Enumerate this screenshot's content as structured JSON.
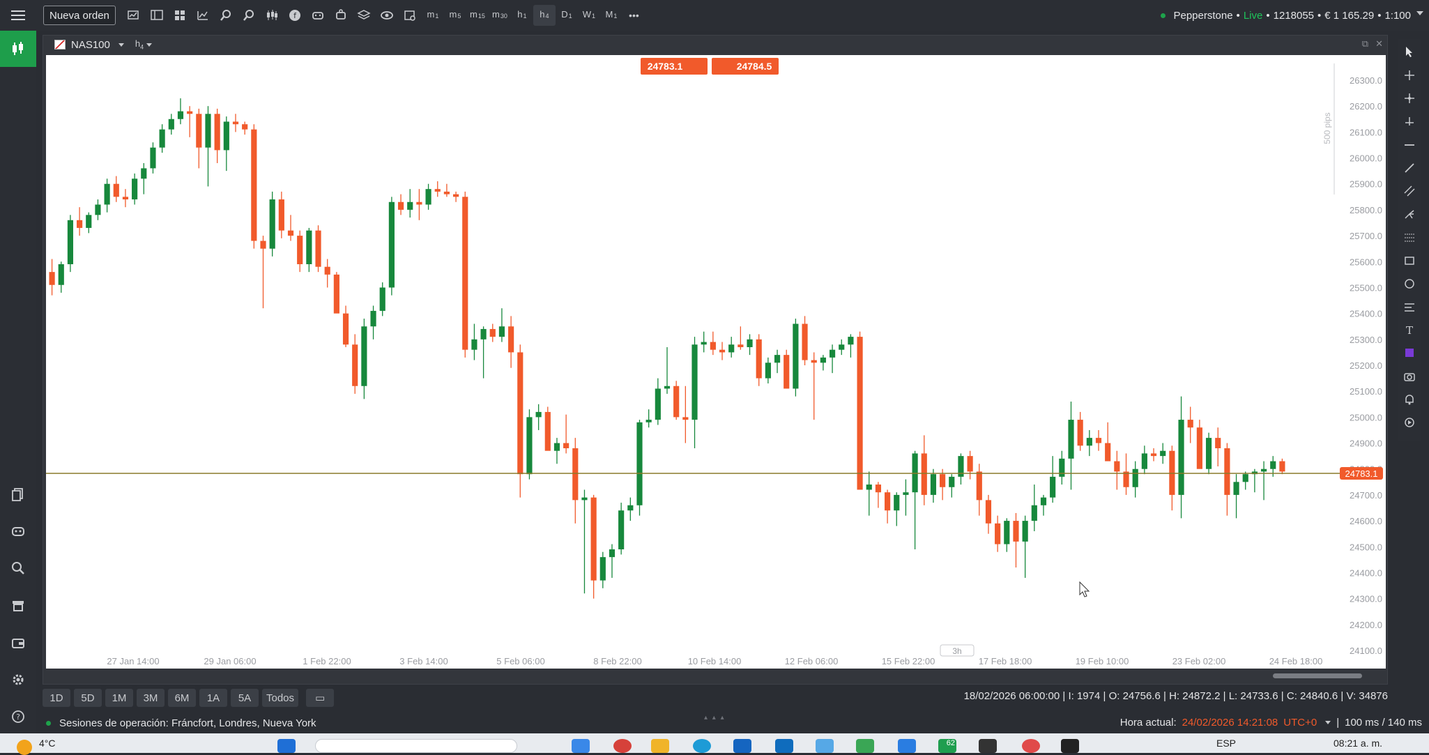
{
  "toolbar": {
    "new_order_label": "Nueva orden",
    "timeframes": [
      {
        "label": "m",
        "sub": "1"
      },
      {
        "label": "m",
        "sub": "5"
      },
      {
        "label": "m",
        "sub": "15"
      },
      {
        "label": "m",
        "sub": "30"
      },
      {
        "label": "h",
        "sub": "1"
      },
      {
        "label": "h",
        "sub": "4"
      },
      {
        "label": "D",
        "sub": "1"
      },
      {
        "label": "W",
        "sub": "1"
      },
      {
        "label": "M",
        "sub": "1"
      }
    ],
    "active_timeframe": "h4",
    "more_label": "•••"
  },
  "account": {
    "broker": "Pepperstone",
    "sep1": "•",
    "mode": "Live",
    "sep2": "•",
    "number": "1218055",
    "sep3": "•",
    "balance": "€ 1 165.29",
    "sep4": "•",
    "leverage": "1:100"
  },
  "chart_window": {
    "symbol": "NAS100",
    "timeframe_label": "h",
    "timeframe_sub": "4",
    "bid_label": "24783.1",
    "ask_label": "24784.5",
    "pips_label": "500 pips",
    "collapsed_label": "3h",
    "price_marker": "24783.1"
  },
  "chart_data": {
    "type": "candlestick",
    "symbol": "NAS100",
    "timeframe": "h4",
    "y_axis_labels": [
      "26300.0",
      "26200.0",
      "26100.0",
      "26000.0",
      "25900.0",
      "25800.0",
      "25700.0",
      "25600.0",
      "25500.0",
      "25400.0",
      "25300.0",
      "25200.0",
      "25100.0",
      "25000.0",
      "24900.0",
      "24800.0",
      "24700.0",
      "24600.0",
      "24500.0",
      "24400.0",
      "24300.0",
      "24200.0",
      "24100.0"
    ],
    "ylim": [
      24100,
      26300
    ],
    "x_axis_labels": [
      "27 Jan 14:00",
      "29 Jan 06:00",
      "1 Feb 22:00",
      "3 Feb 14:00",
      "5 Feb 06:00",
      "8 Feb 22:00",
      "10 Feb 14:00",
      "12 Feb 06:00",
      "15 Feb 22:00",
      "17 Feb 18:00",
      "19 Feb 10:00",
      "23 Feb 02:00",
      "24 Feb 18:00"
    ],
    "current_price": 24783.1,
    "candles": [
      [
        25560,
        25610,
        25470,
        25510
      ],
      [
        25510,
        25600,
        25480,
        25590
      ],
      [
        25590,
        25780,
        25560,
        25760
      ],
      [
        25760,
        25810,
        25700,
        25730
      ],
      [
        25730,
        25790,
        25710,
        25780
      ],
      [
        25780,
        25840,
        25760,
        25820
      ],
      [
        25820,
        25920,
        25790,
        25900
      ],
      [
        25900,
        25930,
        25830,
        25850
      ],
      [
        25850,
        25880,
        25810,
        25840
      ],
      [
        25840,
        25940,
        25820,
        25920
      ],
      [
        25920,
        25980,
        25860,
        25960
      ],
      [
        25960,
        26060,
        25940,
        26040
      ],
      [
        26040,
        26130,
        26020,
        26110
      ],
      [
        26110,
        26170,
        26090,
        26150
      ],
      [
        26150,
        26230,
        26130,
        26180
      ],
      [
        26180,
        26200,
        26080,
        26170
      ],
      [
        26170,
        26190,
        25960,
        26040
      ],
      [
        26040,
        26200,
        25890,
        26170
      ],
      [
        26170,
        26190,
        25980,
        26030
      ],
      [
        26030,
        26160,
        25950,
        26140
      ],
      [
        26140,
        26170,
        26100,
        26130
      ],
      [
        26130,
        26140,
        26090,
        26110
      ],
      [
        26110,
        26130,
        25650,
        25680
      ],
      [
        25680,
        25700,
        25420,
        25650
      ],
      [
        25650,
        25870,
        25620,
        25840
      ],
      [
        25840,
        25870,
        25690,
        25720
      ],
      [
        25720,
        25780,
        25680,
        25700
      ],
      [
        25700,
        25720,
        25560,
        25590
      ],
      [
        25590,
        25730,
        25560,
        25720
      ],
      [
        25720,
        25740,
        25560,
        25580
      ],
      [
        25580,
        25610,
        25500,
        25550
      ],
      [
        25550,
        25560,
        25430,
        25400
      ],
      [
        25400,
        25430,
        25270,
        25280
      ],
      [
        25280,
        25320,
        25090,
        25120
      ],
      [
        25120,
        25380,
        25070,
        25350
      ],
      [
        25350,
        25430,
        25300,
        25410
      ],
      [
        25410,
        25520,
        25390,
        25500
      ],
      [
        25500,
        25850,
        25470,
        25830
      ],
      [
        25830,
        25860,
        25780,
        25800
      ],
      [
        25800,
        25880,
        25770,
        25830
      ],
      [
        25830,
        25880,
        25760,
        25820
      ],
      [
        25820,
        25900,
        25800,
        25880
      ],
      [
        25880,
        25910,
        25850,
        25870
      ],
      [
        25870,
        25900,
        25850,
        25860
      ],
      [
        25860,
        25870,
        25830,
        25850
      ],
      [
        25850,
        25870,
        25230,
        25260
      ],
      [
        25260,
        25360,
        25220,
        25300
      ],
      [
        25300,
        25350,
        25150,
        25340
      ],
      [
        25340,
        25360,
        25290,
        25310
      ],
      [
        25310,
        25420,
        25290,
        25350
      ],
      [
        25350,
        25390,
        25190,
        25250
      ],
      [
        25250,
        25280,
        24690,
        24780
      ],
      [
        24780,
        25030,
        24760,
        25000
      ],
      [
        25000,
        25050,
        24950,
        25020
      ],
      [
        25020,
        25040,
        24880,
        24870
      ],
      [
        24870,
        24920,
        24820,
        24900
      ],
      [
        24900,
        25010,
        24860,
        24880
      ],
      [
        24880,
        24920,
        24590,
        24680
      ],
      [
        24680,
        24720,
        24320,
        24690
      ],
      [
        24690,
        24700,
        24300,
        24370
      ],
      [
        24370,
        24480,
        24340,
        24460
      ],
      [
        24460,
        24510,
        24380,
        24490
      ],
      [
        24490,
        24670,
        24470,
        24640
      ],
      [
        24640,
        24690,
        24600,
        24660
      ],
      [
        24660,
        24990,
        24620,
        24980
      ],
      [
        24980,
        25030,
        24960,
        24990
      ],
      [
        24990,
        25150,
        24970,
        25110
      ],
      [
        25110,
        25270,
        25090,
        25120
      ],
      [
        25120,
        25140,
        24990,
        25000
      ],
      [
        25000,
        25120,
        24900,
        24990
      ],
      [
        24990,
        25310,
        24880,
        25280
      ],
      [
        25280,
        25330,
        25250,
        25290
      ],
      [
        25290,
        25330,
        25240,
        25260
      ],
      [
        25260,
        25290,
        25220,
        25250
      ],
      [
        25250,
        25310,
        25230,
        25280
      ],
      [
        25280,
        25350,
        25260,
        25270
      ],
      [
        25270,
        25320,
        25240,
        25300
      ],
      [
        25300,
        25320,
        25120,
        25150
      ],
      [
        25150,
        25230,
        25130,
        25210
      ],
      [
        25210,
        25260,
        25170,
        25240
      ],
      [
        25240,
        25260,
        25120,
        25110
      ],
      [
        25110,
        25380,
        25080,
        25360
      ],
      [
        25360,
        25390,
        25200,
        25220
      ],
      [
        25220,
        25250,
        24990,
        25210
      ],
      [
        25210,
        25240,
        25180,
        25230
      ],
      [
        25230,
        25280,
        25170,
        25260
      ],
      [
        25260,
        25300,
        25240,
        25280
      ],
      [
        25280,
        25320,
        25230,
        25310
      ],
      [
        25310,
        25330,
        24750,
        24720
      ],
      [
        24720,
        24790,
        24620,
        24740
      ],
      [
        24740,
        24750,
        24650,
        24710
      ],
      [
        24710,
        24720,
        24590,
        24640
      ],
      [
        24640,
        24710,
        24580,
        24700
      ],
      [
        24700,
        24760,
        24620,
        24710
      ],
      [
        24710,
        24870,
        24490,
        24860
      ],
      [
        24860,
        24930,
        24660,
        24700
      ],
      [
        24700,
        24800,
        24670,
        24780
      ],
      [
        24780,
        24800,
        24680,
        24730
      ],
      [
        24730,
        24780,
        24690,
        24770
      ],
      [
        24770,
        24860,
        24740,
        24850
      ],
      [
        24850,
        24870,
        24760,
        24790
      ],
      [
        24790,
        24820,
        24620,
        24680
      ],
      [
        24680,
        24700,
        24550,
        24590
      ],
      [
        24590,
        24620,
        24480,
        24510
      ],
      [
        24510,
        24610,
        24480,
        24600
      ],
      [
        24600,
        24630,
        24420,
        24520
      ],
      [
        24520,
        24620,
        24380,
        24600
      ],
      [
        24600,
        24740,
        24560,
        24660
      ],
      [
        24660,
        24700,
        24620,
        24690
      ],
      [
        24690,
        24850,
        24670,
        24770
      ],
      [
        24770,
        24870,
        24740,
        24840
      ],
      [
        24840,
        25060,
        24720,
        24990
      ],
      [
        24990,
        25020,
        24870,
        24890
      ],
      [
        24890,
        24950,
        24850,
        24920
      ],
      [
        24920,
        24950,
        24870,
        24900
      ],
      [
        24900,
        24980,
        24860,
        24830
      ],
      [
        24830,
        24870,
        24720,
        24790
      ],
      [
        24790,
        24860,
        24700,
        24730
      ],
      [
        24730,
        24830,
        24690,
        24800
      ],
      [
        24800,
        24890,
        24780,
        24860
      ],
      [
        24860,
        24880,
        24830,
        24850
      ],
      [
        24850,
        24900,
        24820,
        24870
      ],
      [
        24870,
        24890,
        24640,
        24700
      ],
      [
        24700,
        25080,
        24610,
        24990
      ],
      [
        24990,
        25040,
        24900,
        24960
      ],
      [
        24960,
        24990,
        24810,
        24800
      ],
      [
        24800,
        24940,
        24780,
        24920
      ],
      [
        24920,
        24960,
        24810,
        24880
      ],
      [
        24880,
        24900,
        24620,
        24700
      ],
      [
        24700,
        24780,
        24610,
        24750
      ],
      [
        24750,
        24790,
        24720,
        24780
      ],
      [
        24780,
        24800,
        24710,
        24790
      ],
      [
        24790,
        24830,
        24680,
        24800
      ],
      [
        24800,
        24850,
        24770,
        24830
      ],
      [
        24830,
        24840,
        24780,
        24790
      ]
    ]
  },
  "range_buttons": [
    "1D",
    "5D",
    "1M",
    "3M",
    "6M",
    "1A",
    "5A",
    "Todos"
  ],
  "ohlc": {
    "date": "18/02/2026 06:00:00",
    "sep": "|",
    "i": "I: 1974",
    "o": "O: 24756.6",
    "h": "H: 24872.2",
    "l": "L: 24733.6",
    "c": "C: 24840.6",
    "v": "V: 34876"
  },
  "status": {
    "sessions": "Sesiones de operación: Fráncfort, Londres, Nueva York",
    "time_label": "Hora actual:",
    "time_value": "24/02/2026 14:21:08",
    "tz": "UTC+0",
    "latency": "100 ms / 140 ms"
  },
  "taskbar": {
    "weather": "4°C",
    "lang": "ESP",
    "clock": "08:21 a. m.",
    "badge": "62"
  },
  "colors": {
    "bull": "#17883c",
    "bear": "#f15a2b",
    "price_line": "#8a7a2a",
    "accent": "#1e9e4b"
  }
}
